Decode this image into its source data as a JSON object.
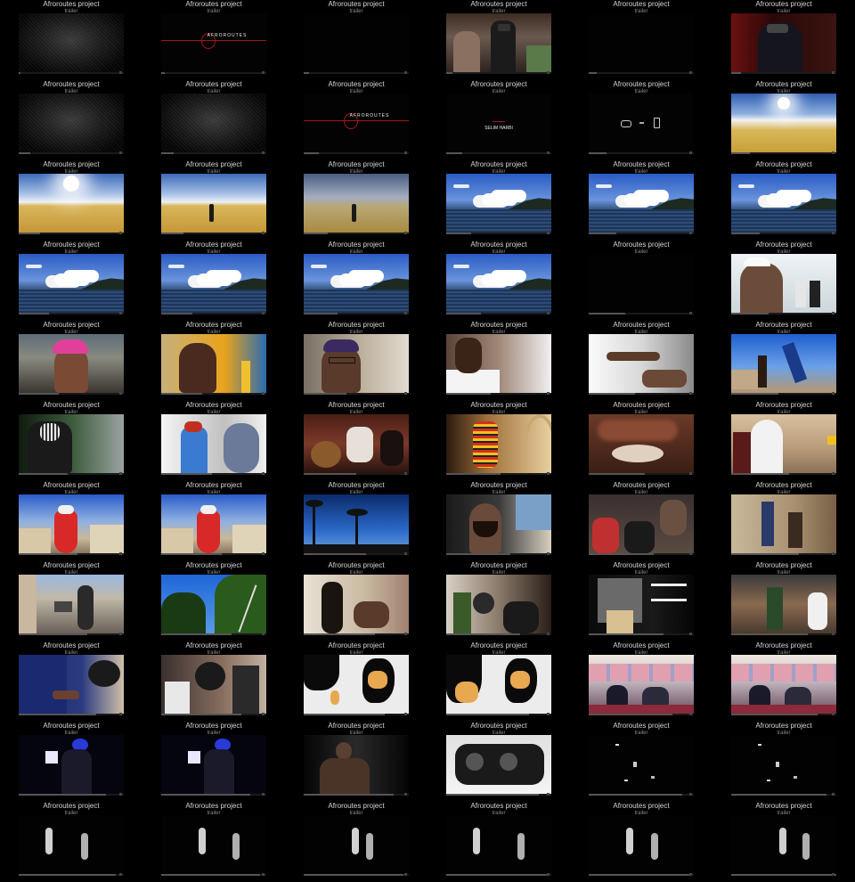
{
  "sheet": {
    "title": "Afroroutes project",
    "subtitle": "trailer",
    "columns": 6,
    "rows": 11
  },
  "frames": [
    {
      "scene": "dark-texture"
    },
    {
      "scene": "logo-line",
      "text": "AFROROUTES"
    },
    {
      "scene": "black"
    },
    {
      "scene": "vr-room"
    },
    {
      "scene": "black"
    },
    {
      "scene": "vr-portrait"
    },
    {
      "scene": "dark-texture"
    },
    {
      "scene": "dark-texture"
    },
    {
      "scene": "logo-line",
      "text": "AFROROUTES"
    },
    {
      "scene": "credit",
      "text": "SELIM HARBI"
    },
    {
      "scene": "devices"
    },
    {
      "scene": "desert-sun"
    },
    {
      "scene": "desert"
    },
    {
      "scene": "desert-figure"
    },
    {
      "scene": "desert-figure-dusk"
    },
    {
      "scene": "sea"
    },
    {
      "scene": "sea"
    },
    {
      "scene": "sea"
    },
    {
      "scene": "sea"
    },
    {
      "scene": "sea"
    },
    {
      "scene": "sea"
    },
    {
      "scene": "sea"
    },
    {
      "scene": "black"
    },
    {
      "scene": "street-people"
    },
    {
      "scene": "portrait-pink"
    },
    {
      "scene": "portrait-yellow"
    },
    {
      "scene": "portrait-glasses"
    },
    {
      "scene": "portrait-white"
    },
    {
      "scene": "hands-white"
    },
    {
      "scene": "capoeira"
    },
    {
      "scene": "masked-figure"
    },
    {
      "scene": "blue-dress"
    },
    {
      "scene": "musicians"
    },
    {
      "scene": "beads"
    },
    {
      "scene": "shell"
    },
    {
      "scene": "white-robes"
    },
    {
      "scene": "baiana"
    },
    {
      "scene": "baiana"
    },
    {
      "scene": "palms"
    },
    {
      "scene": "car-man"
    },
    {
      "scene": "market-crowd"
    },
    {
      "scene": "wall-street"
    },
    {
      "scene": "street-walk"
    },
    {
      "scene": "trees-sky"
    },
    {
      "scene": "interior-men"
    },
    {
      "scene": "interior-drum"
    },
    {
      "scene": "calligraphy"
    },
    {
      "scene": "street-dance"
    },
    {
      "scene": "drummer-blue"
    },
    {
      "scene": "drummer-group"
    },
    {
      "scene": "map-light"
    },
    {
      "scene": "map-orange"
    },
    {
      "scene": "ceremony-room"
    },
    {
      "scene": "ceremony-room"
    },
    {
      "scene": "dark-blue-figure"
    },
    {
      "scene": "dark-blue-figure"
    },
    {
      "scene": "shirtless-man"
    },
    {
      "scene": "vr-headset"
    },
    {
      "scene": "dark-points"
    },
    {
      "scene": "dark-points"
    },
    {
      "scene": "dark-dancers"
    },
    {
      "scene": "dark-dancers"
    },
    {
      "scene": "dark-dancers"
    },
    {
      "scene": "dark-dancers"
    },
    {
      "scene": "dark-dancers"
    },
    {
      "scene": "dark-dancers"
    }
  ]
}
